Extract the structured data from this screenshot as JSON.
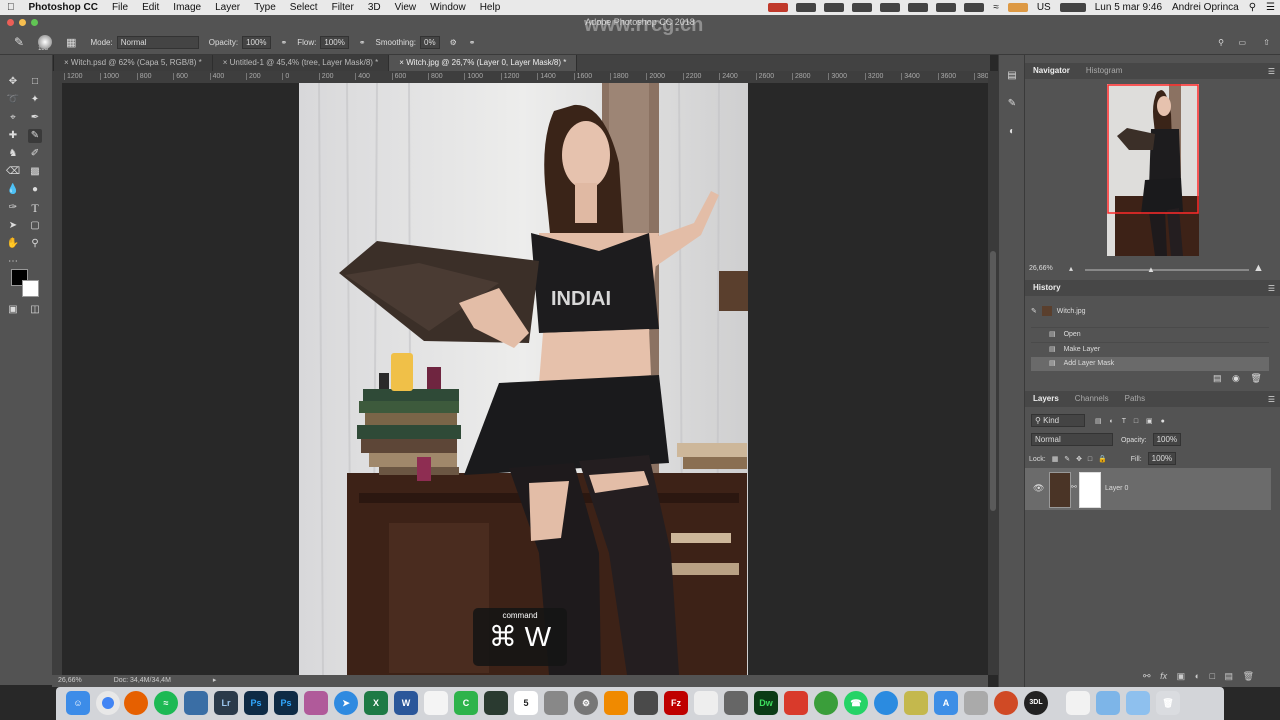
{
  "menubar": {
    "app_name": "Photoshop CC",
    "items": [
      "File",
      "Edit",
      "Image",
      "Layer",
      "Type",
      "Select",
      "Filter",
      "3D",
      "View",
      "Window",
      "Help"
    ],
    "language": "US",
    "datetime": "Lun 5 mar  9:46",
    "user": "Andrei Oprinca"
  },
  "window": {
    "title": "Adobe Photoshop CC 2018",
    "watermark": "www.rrcg.cn"
  },
  "options": {
    "brush_size": "185",
    "mode_label": "Mode:",
    "mode_value": "Normal",
    "opacity_label": "Opacity:",
    "opacity_value": "100%",
    "flow_label": "Flow:",
    "flow_value": "100%",
    "smoothing_label": "Smoothing:",
    "smoothing_value": "0%"
  },
  "tabs": [
    {
      "label": "Witch.psd @ 62% (Capa 5, RGB/8) *"
    },
    {
      "label": "Untitled-1 @ 45,4% (tree, Layer Mask/8) *"
    },
    {
      "label": "Witch.jpg @ 26,7% (Layer 0, Layer Mask/8) *"
    }
  ],
  "ruler": {
    "ticks": [
      "1200",
      "1000",
      "800",
      "600",
      "400",
      "200",
      "0",
      "200",
      "400",
      "600",
      "800",
      "1000",
      "1200",
      "1400",
      "1600",
      "1800",
      "2000",
      "2200",
      "2400",
      "2600",
      "2800",
      "3000",
      "3200",
      "3400",
      "3600",
      "380"
    ]
  },
  "shirt_text": "INDIAI",
  "status": {
    "zoom": "26,66%",
    "doc": "Doc: 34,4M/34,4M"
  },
  "overlay": {
    "caption": "command",
    "keys": "⌘ W"
  },
  "navigator": {
    "tabs": [
      "Navigator",
      "Histogram"
    ],
    "zoom": "26,66%"
  },
  "history": {
    "title": "History",
    "snapshot": "Witch.jpg",
    "items": [
      "Open",
      "Make Layer",
      "Add Layer Mask"
    ]
  },
  "layers": {
    "tabs": [
      "Layers",
      "Channels",
      "Paths"
    ],
    "filter_label": "Kind",
    "blend_mode": "Normal",
    "opacity_label": "Opacity:",
    "opacity_value": "100%",
    "lock_label": "Lock:",
    "fill_label": "Fill:",
    "fill_value": "100%",
    "layer_name": "Layer 0"
  },
  "dock": {
    "apps": [
      "Finder",
      "Chrome",
      "Firefox",
      "Spotify",
      "",
      "Lr",
      "Ps",
      "Ps",
      "",
      "Safari",
      "Excel",
      "Word",
      "",
      "C",
      "",
      "5",
      "",
      "",
      "",
      "",
      "Fz",
      "",
      "Dw",
      "",
      "",
      "",
      "",
      "",
      "",
      "",
      "",
      "",
      "3DL",
      "",
      "",
      "",
      ""
    ],
    "calendar_day": "5"
  },
  "colors": {
    "accent_nav": "#ff2a2a",
    "panel": "#535353",
    "canvas": "#282828"
  }
}
